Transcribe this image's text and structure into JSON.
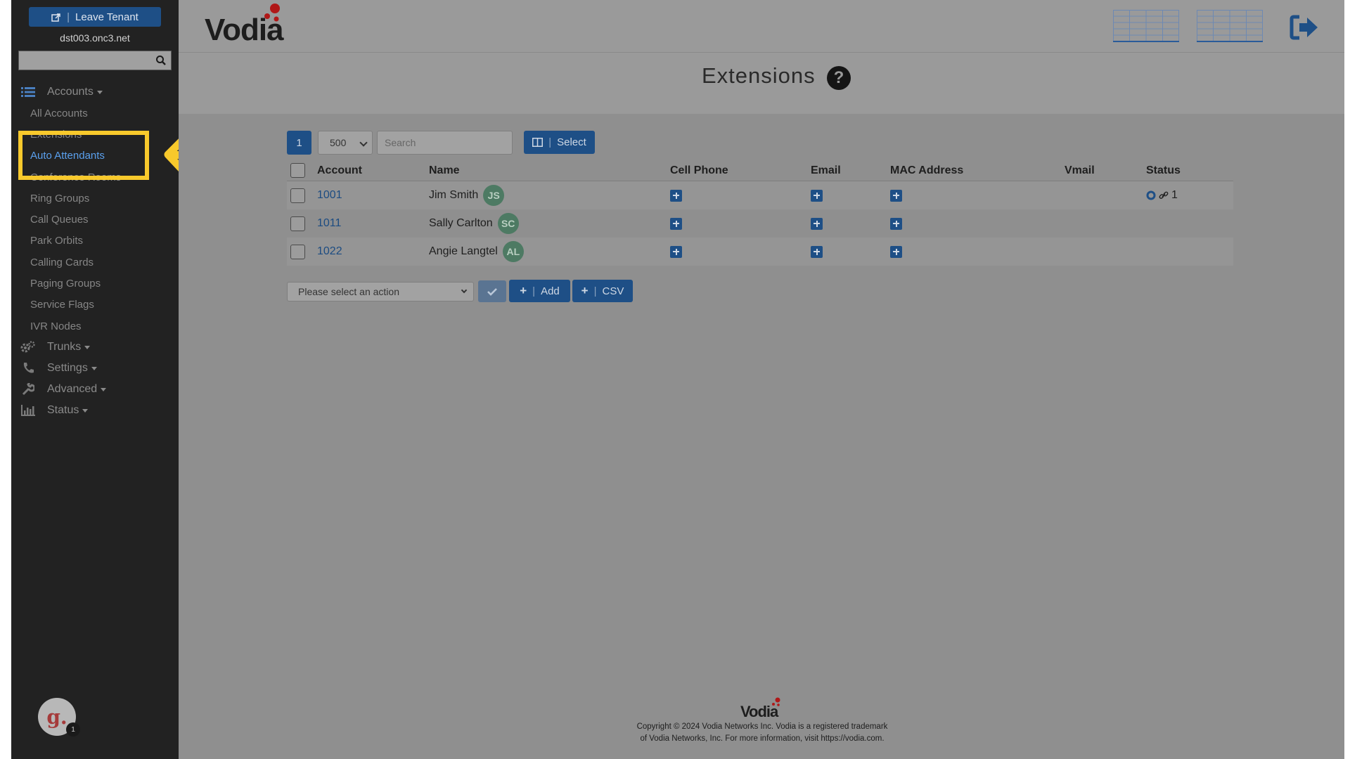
{
  "sidebar": {
    "leave_tenant_label": "Leave Tenant",
    "domain": "dst003.onc3.net",
    "search_placeholder": "",
    "groups": {
      "accounts": "Accounts",
      "trunks": "Trunks",
      "settings": "Settings",
      "advanced": "Advanced",
      "status": "Status"
    },
    "items": [
      {
        "label": "All Accounts"
      },
      {
        "label": "Extensions"
      },
      {
        "label": "Auto Attendants"
      },
      {
        "label": "Conference Rooms"
      },
      {
        "label": "Ring Groups"
      },
      {
        "label": "Call Queues"
      },
      {
        "label": "Park Orbits"
      },
      {
        "label": "Calling Cards"
      },
      {
        "label": "Paging Groups"
      },
      {
        "label": "Service Flags"
      },
      {
        "label": "IVR Nodes"
      }
    ],
    "avatar_letter": "g.",
    "avatar_badge": "1"
  },
  "header": {
    "logo": "Vodia"
  },
  "page": {
    "title": "Extensions",
    "help": "?"
  },
  "toolbar": {
    "page": "1",
    "per_page": "500",
    "search_placeholder": "Search",
    "select_label": "Select"
  },
  "table": {
    "headers": {
      "account": "Account",
      "name": "Name",
      "cell_phone": "Cell Phone",
      "email": "Email",
      "mac": "MAC Address",
      "vmail": "Vmail",
      "status": "Status"
    },
    "rows": [
      {
        "account": "1001",
        "name": "Jim Smith",
        "initials": "JS",
        "status_count": "1"
      },
      {
        "account": "1011",
        "name": "Sally Carlton",
        "initials": "SC",
        "status_count": ""
      },
      {
        "account": "1022",
        "name": "Angie Langtel",
        "initials": "AL",
        "status_count": ""
      }
    ]
  },
  "actions": {
    "select_placeholder": "Please select an action",
    "add_label": "Add",
    "csv_label": "CSV"
  },
  "footer": {
    "logo": "Vodia",
    "copyright": "Copyright © 2024 Vodia Networks Inc. Vodia is a registered trademark of Vodia Networks, Inc. For more information, visit https://vodia.com."
  },
  "colors": {
    "highlight": "#f8c92c",
    "primary_button": "#1e4f86",
    "active_link": "#5aa0ee"
  }
}
